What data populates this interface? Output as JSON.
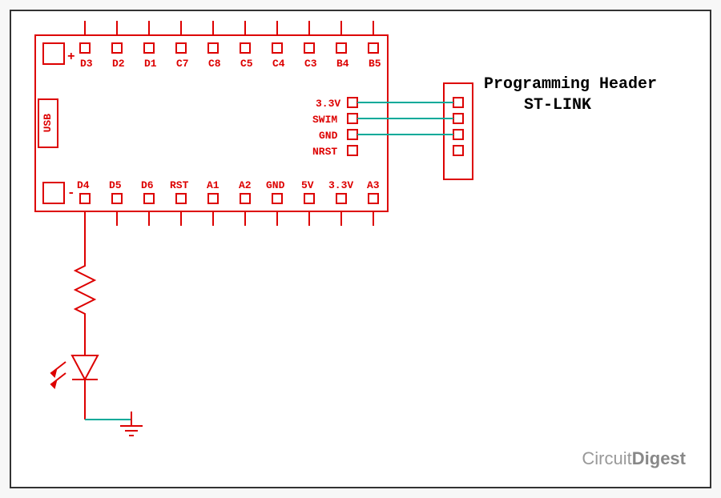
{
  "topPins": [
    "D3",
    "D2",
    "D1",
    "C7",
    "C8",
    "C5",
    "C4",
    "C3",
    "B4",
    "B5"
  ],
  "bottomPins": [
    "D4",
    "D5",
    "D6",
    "RST",
    "A1",
    "A2",
    "GND",
    "5V",
    "3.3V",
    "A3"
  ],
  "innerHeader": [
    "3.3V",
    "SWIM",
    "GND",
    "NRST"
  ],
  "usbLabel": "USB",
  "polarityPlus": "+",
  "polarityMinus": "-",
  "headerTitle1": "Programming Header",
  "headerTitle2": "ST-LINK",
  "watermark": {
    "part1": "Circuit",
    "part2": "Digest"
  }
}
